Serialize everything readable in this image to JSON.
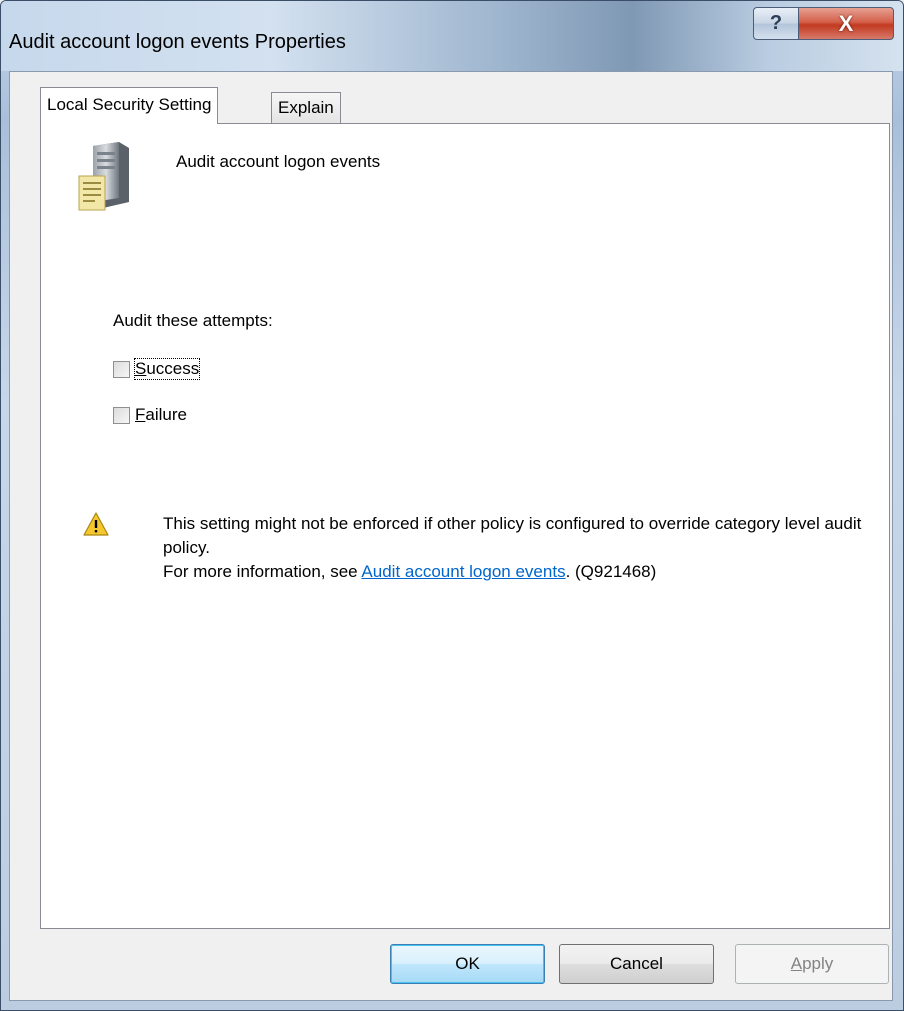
{
  "window": {
    "title": "Audit account logon events Properties",
    "help_glyph": "?",
    "close_glyph": "X"
  },
  "tabs": [
    {
      "label": "Local Security Setting",
      "active": true
    },
    {
      "label": "Explain",
      "active": false
    }
  ],
  "policy": {
    "name": "Audit account logon events",
    "icon": "server-document-icon"
  },
  "audit": {
    "label": "Audit these attempts:",
    "options": [
      {
        "mnemonic": "S",
        "rest": "uccess",
        "checked": false,
        "focused": true
      },
      {
        "mnemonic": "F",
        "rest": "ailure",
        "checked": false,
        "focused": false
      }
    ]
  },
  "warning": {
    "icon": "warning-icon",
    "line1": "This setting might not be enforced if other policy is configured to override category level audit policy.",
    "line2_prefix": "For more information, see ",
    "link_text": "Audit account logon events",
    "line2_suffix": ". (Q921468)"
  },
  "buttons": {
    "ok": "OK",
    "cancel": "Cancel",
    "apply_mnemonic": "A",
    "apply_rest": "pply"
  },
  "colors": {
    "link": "#0066cc",
    "close_button": "#c2391f",
    "default_button_border": "#3c7fb1"
  }
}
